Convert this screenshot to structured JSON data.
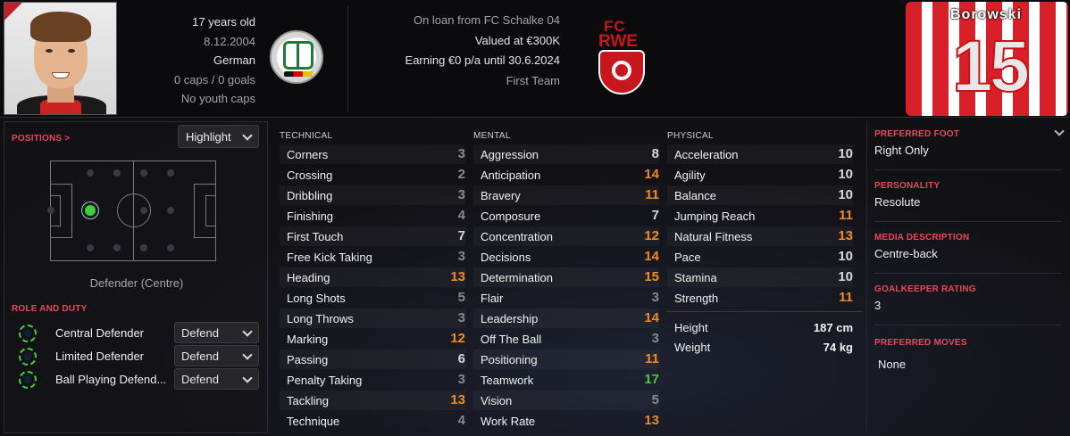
{
  "header": {
    "bio": [
      "17 years old",
      "8.12.2004",
      "German",
      "0 caps / 0 goals",
      "No youth caps"
    ],
    "contract": [
      "On loan from FC Schalke 04",
      "Valued at €300K",
      "Earning €0 p/a until 30.6.2024",
      "First Team"
    ],
    "shirt_name": "Borowski",
    "shirt_number": "15",
    "club_logo_top": "FC",
    "club_logo_mid": "RWE"
  },
  "positions": {
    "title": "POSITIONS >",
    "highlight_label": "Highlight",
    "position_label": "Defender (Centre)"
  },
  "roles": {
    "title": "ROLE AND DUTY",
    "items": [
      {
        "name": "Central Defender",
        "duty": "Defend"
      },
      {
        "name": "Limited Defender",
        "duty": "Defend"
      },
      {
        "name": "Ball Playing Defend...",
        "duty": "Defend"
      }
    ]
  },
  "attributes": {
    "technical": {
      "title": "TECHNICAL",
      "items": [
        {
          "name": "Corners",
          "value": "3",
          "tone": "grey"
        },
        {
          "name": "Crossing",
          "value": "2",
          "tone": "grey"
        },
        {
          "name": "Dribbling",
          "value": "3",
          "tone": "grey"
        },
        {
          "name": "Finishing",
          "value": "4",
          "tone": "grey"
        },
        {
          "name": "First Touch",
          "value": "7",
          "tone": "white"
        },
        {
          "name": "Free Kick Taking",
          "value": "3",
          "tone": "grey"
        },
        {
          "name": "Heading",
          "value": "13",
          "tone": "orange"
        },
        {
          "name": "Long Shots",
          "value": "5",
          "tone": "grey"
        },
        {
          "name": "Long Throws",
          "value": "3",
          "tone": "grey"
        },
        {
          "name": "Marking",
          "value": "12",
          "tone": "orange"
        },
        {
          "name": "Passing",
          "value": "6",
          "tone": "white"
        },
        {
          "name": "Penalty Taking",
          "value": "3",
          "tone": "grey"
        },
        {
          "name": "Tackling",
          "value": "13",
          "tone": "orange"
        },
        {
          "name": "Technique",
          "value": "4",
          "tone": "grey"
        }
      ]
    },
    "mental": {
      "title": "MENTAL",
      "items": [
        {
          "name": "Aggression",
          "value": "8",
          "tone": "white"
        },
        {
          "name": "Anticipation",
          "value": "14",
          "tone": "orange"
        },
        {
          "name": "Bravery",
          "value": "11",
          "tone": "orange"
        },
        {
          "name": "Composure",
          "value": "7",
          "tone": "white"
        },
        {
          "name": "Concentration",
          "value": "12",
          "tone": "orange"
        },
        {
          "name": "Decisions",
          "value": "14",
          "tone": "orange"
        },
        {
          "name": "Determination",
          "value": "15",
          "tone": "orange"
        },
        {
          "name": "Flair",
          "value": "3",
          "tone": "grey"
        },
        {
          "name": "Leadership",
          "value": "14",
          "tone": "orange"
        },
        {
          "name": "Off The Ball",
          "value": "3",
          "tone": "grey"
        },
        {
          "name": "Positioning",
          "value": "11",
          "tone": "orange"
        },
        {
          "name": "Teamwork",
          "value": "17",
          "tone": "green"
        },
        {
          "name": "Vision",
          "value": "5",
          "tone": "grey"
        },
        {
          "name": "Work Rate",
          "value": "13",
          "tone": "orange"
        }
      ]
    },
    "physical": {
      "title": "PHYSICAL",
      "items": [
        {
          "name": "Acceleration",
          "value": "10",
          "tone": "white"
        },
        {
          "name": "Agility",
          "value": "10",
          "tone": "white"
        },
        {
          "name": "Balance",
          "value": "10",
          "tone": "white"
        },
        {
          "name": "Jumping Reach",
          "value": "11",
          "tone": "orange"
        },
        {
          "name": "Natural Fitness",
          "value": "13",
          "tone": "orange"
        },
        {
          "name": "Pace",
          "value": "10",
          "tone": "white"
        },
        {
          "name": "Stamina",
          "value": "10",
          "tone": "white"
        },
        {
          "name": "Strength",
          "value": "11",
          "tone": "orange"
        }
      ],
      "height_label": "Height",
      "height_value": "187 cm",
      "weight_label": "Weight",
      "weight_value": "74 kg"
    }
  },
  "info": {
    "preferred_foot_title": "PREFERRED FOOT",
    "preferred_foot": "Right Only",
    "personality_title": "PERSONALITY",
    "personality": "Resolute",
    "media_title": "MEDIA DESCRIPTION",
    "media": "Centre-back",
    "gk_title": "GOALKEEPER RATING",
    "gk": "3",
    "moves_title": "PREFERRED MOVES",
    "moves": "None"
  },
  "colors": {
    "accent_red": "#e64a5a",
    "orange": "#f08a24",
    "green": "#4cc83c",
    "grey": "#8a8a8a",
    "white": "#d8d8d8"
  }
}
